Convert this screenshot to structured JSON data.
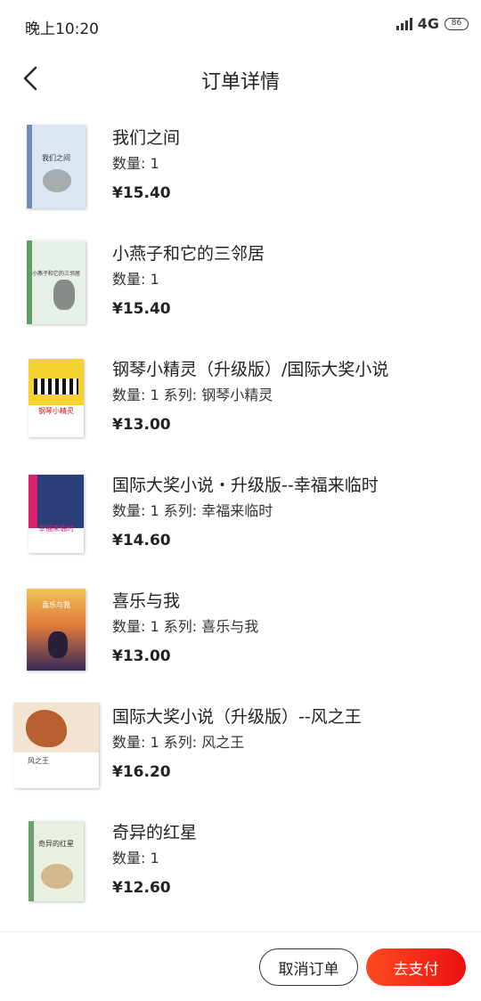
{
  "status_bar": {
    "time": "晚上10:20",
    "network": "4G",
    "battery": "86",
    "icons": [
      "signal-icon",
      "battery-icon"
    ]
  },
  "header": {
    "title": "订单详情",
    "back_icon": "chevron-left-icon"
  },
  "items": [
    {
      "name": "我们之间",
      "spec": "数量: 1",
      "price": "¥15.40",
      "cover_title": "我们之间",
      "cover_color": "#dbe6f2",
      "accent": "#6b8fb5"
    },
    {
      "name": "小燕子和它的三邻居",
      "spec": "数量: 1",
      "price": "¥15.40",
      "cover_title": "小燕子和它的三邻居",
      "cover_color": "#e6f0e6",
      "accent": "#5e9c6a"
    },
    {
      "name": "钢琴小精灵（升级版）/国际大奖小说",
      "spec": "数量: 1 系列: 钢琴小精灵",
      "price": "¥13.00",
      "cover_title": "钢琴小精灵",
      "cover_color": "#f4d230",
      "accent": "#1a1a1a"
    },
    {
      "name": "国际大奖小说・升级版--幸福来临时",
      "spec": "数量: 1 系列: 幸福来临时",
      "price": "¥14.60",
      "cover_title": "幸福来临时",
      "cover_color": "#2a3f7a",
      "accent": "#d8206b"
    },
    {
      "name": "喜乐与我",
      "spec": "数量: 1 系列: 喜乐与我",
      "price": "¥13.00",
      "cover_title": "喜乐与我",
      "cover_color": "#e6a24a",
      "accent": "#3a2a5a"
    },
    {
      "name": "国际大奖小说（升级版）--风之王",
      "spec": "数量: 1 系列: 风之王",
      "price": "¥16.20",
      "cover_title": "风之王",
      "cover_color": "#f3e4d2",
      "accent": "#b5602e"
    },
    {
      "name": "奇异的红星",
      "spec": "数量: 1",
      "price": "¥12.60",
      "cover_title": "奇异的红星",
      "cover_color": "#e8f0e2",
      "accent": "#6aa06a"
    }
  ],
  "footer": {
    "cancel_label": "取消订单",
    "pay_label": "去支付",
    "pay_color": "#f0221a"
  }
}
